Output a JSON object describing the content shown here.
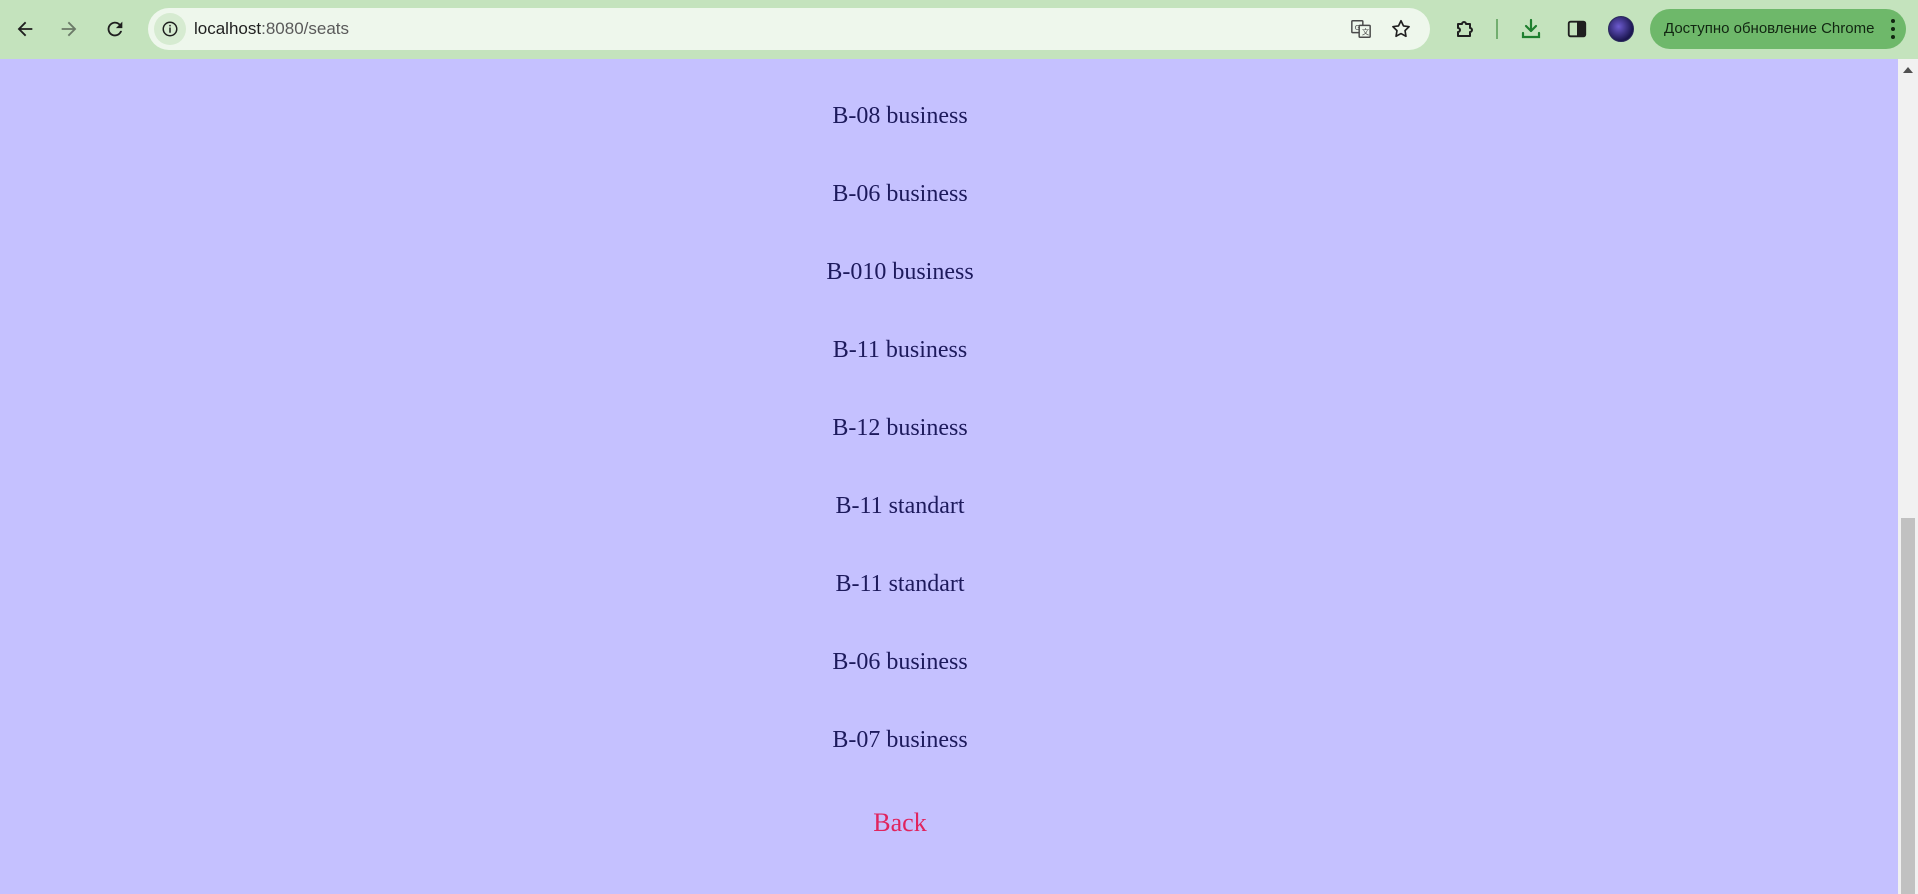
{
  "browser": {
    "url_host": "localhost",
    "url_path": ":8080/seats",
    "update_label": "Доступно обновление Chrome",
    "icons": [
      "back-arrow-icon",
      "forward-arrow-icon",
      "reload-icon",
      "site-info-icon",
      "translate-icon",
      "bookmark-star-icon",
      "extensions-icon",
      "download-icon",
      "side-panel-icon",
      "profile-avatar",
      "kebab-menu-icon"
    ]
  },
  "seats": [
    {
      "label": "B-08 business"
    },
    {
      "label": "B-06 business"
    },
    {
      "label": "B-010 business"
    },
    {
      "label": "B-11 business"
    },
    {
      "label": "B-12 business"
    },
    {
      "label": "B-11 standart"
    },
    {
      "label": "B-11 standart"
    },
    {
      "label": "B-06 business"
    },
    {
      "label": "B-07 business"
    }
  ],
  "back_label": "Back",
  "colors": {
    "page_background": "#c5c1ff",
    "seat_text": "#1d1a5c",
    "back_link": "#e0245e",
    "toolbar": "#c4e3bd",
    "update_pill": "#6eb86a"
  }
}
